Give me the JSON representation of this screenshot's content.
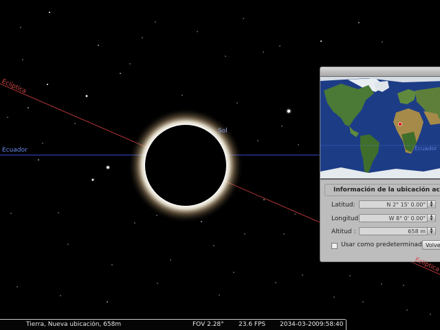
{
  "sky": {
    "ecliptic_label": "Eclíptica",
    "equator_label": "Ecuador",
    "sun_label": "Sol",
    "colors": {
      "ecliptic": "#c83c3c",
      "equator": "#3c50dc",
      "sun_label": "#8fa8e6"
    }
  },
  "location_window": {
    "map_equator_label": "Ecuador",
    "info_title": "Información de la ubicación actual",
    "latitude_label": "Latitud:",
    "latitude_value": "N 2° 15' 0.00\"",
    "longitude_label": "Longitud:",
    "longitude_value": "W 8° 0' 0.00\"",
    "altitude_label": "Altitud :",
    "altitude_value": "658 m",
    "default_checkbox_label": "Usar como predeterminado",
    "default_checked": false,
    "return_button": "Volver"
  },
  "statusbar": {
    "location": "Tierra, Nueva ubicación, 658m",
    "fov": "FOV 2.28°",
    "fps": "23.6 FPS",
    "date": "2034-03-20",
    "time": "09:58:40"
  }
}
